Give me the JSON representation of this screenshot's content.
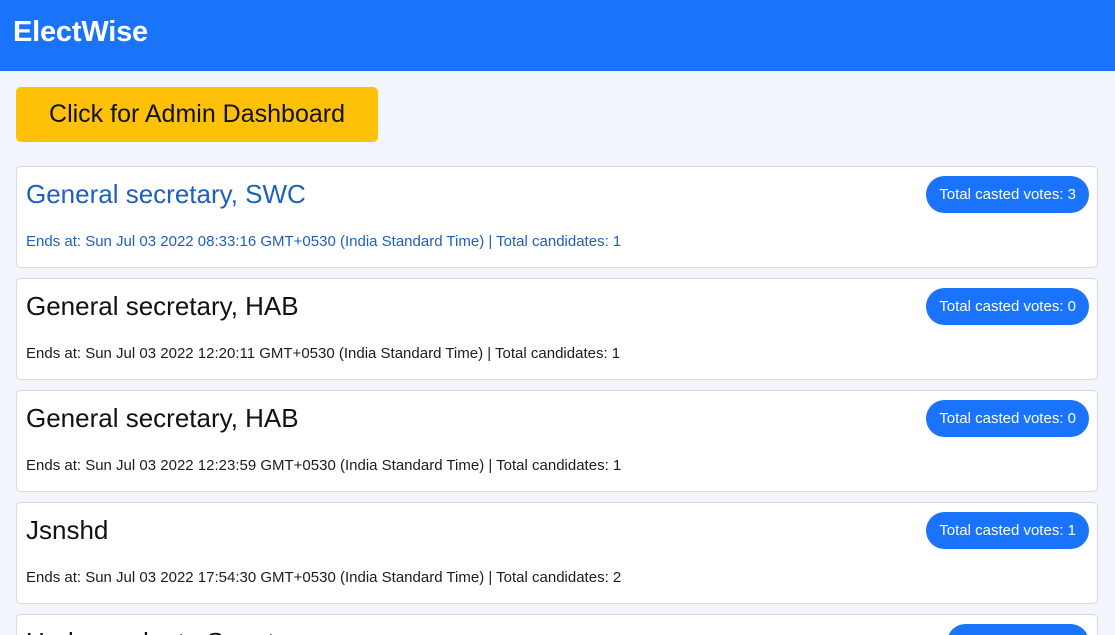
{
  "app": {
    "brand": "ElectWise",
    "admin_button_label": "Click for Admin Dashboard"
  },
  "colors": {
    "navbar": "#1a73fb",
    "admin_button": "#ffc107",
    "badge": "#1a73fb",
    "active_text": "#1f5fbf"
  },
  "elections": [
    {
      "title": "General secretary, SWC",
      "meta": "Ends at: Sun Jul 03 2022 08:33:16 GMT+0530 (India Standard Time) | Total candidates: 1",
      "badge": "Total casted votes: 3",
      "active": true
    },
    {
      "title": "General secretary, HAB",
      "meta": "Ends at: Sun Jul 03 2022 12:20:11 GMT+0530 (India Standard Time) | Total candidates: 1",
      "badge": "Total casted votes: 0",
      "active": false
    },
    {
      "title": "General secretary, HAB",
      "meta": "Ends at: Sun Jul 03 2022 12:23:59 GMT+0530 (India Standard Time) | Total candidates: 1",
      "badge": "Total casted votes: 0",
      "active": false
    },
    {
      "title": "Jsnshd",
      "meta": "Ends at: Sun Jul 03 2022 17:54:30 GMT+0530 (India Standard Time) | Total candidates: 2",
      "badge": "Total casted votes: 1",
      "active": false
    },
    {
      "title": "Undergraduate Senator",
      "meta": "",
      "badge": "",
      "active": false
    }
  ]
}
